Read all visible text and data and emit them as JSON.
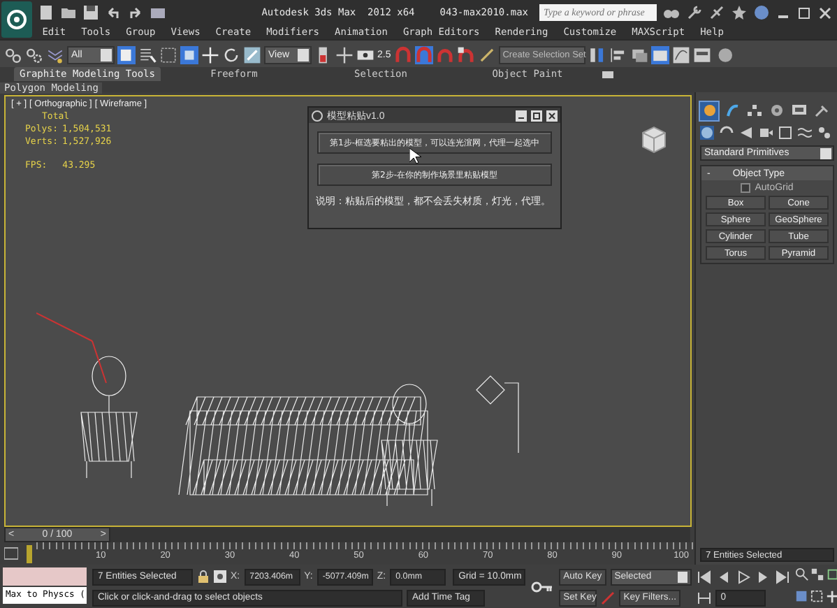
{
  "title_bar": {
    "title": "Autodesk 3ds Max  2012 x64",
    "file": "043-max2010.max",
    "search": {
      "placeholder": "Type a keyword or phrase"
    }
  },
  "menu": [
    "Edit",
    "Tools",
    "Group",
    "Views",
    "Create",
    "Modifiers",
    "Animation",
    "Graph Editors",
    "Rendering",
    "Customize",
    "MAXScript",
    "Help"
  ],
  "toolbar": {
    "selection_filter": "All",
    "reference_coord": "View",
    "snap_angle": "2.5",
    "named_selection": {
      "placeholder": "Create Selection Set"
    }
  },
  "ribbon": {
    "tabs": [
      {
        "label": "Graphite Modeling Tools",
        "selected": true
      },
      {
        "label": "Freeform",
        "selected": false
      },
      {
        "label": "Selection",
        "selected": false
      },
      {
        "label": "Object Paint",
        "selected": false
      }
    ],
    "panel": "Polygon Modeling"
  },
  "viewport": {
    "labels": [
      "[ + ]",
      "[ Orthographic ]",
      "[ Wireframe ]"
    ],
    "heading": "Total",
    "stats": [
      {
        "label": "Polys:",
        "value": "1,504,531"
      },
      {
        "label": "Verts:",
        "value": "1,527,926"
      }
    ],
    "fps": {
      "label": "FPS:",
      "value": "43.295"
    }
  },
  "dialog": {
    "title": "模型粘贴v1.0",
    "buttons": [
      "第1步-框选要粘出的模型，可以连光渲网，代理一起选中",
      "第2步-在你的制作场景里粘贴模型"
    ],
    "note": "说明：粘贴后的模型，都不会丢失材质，灯光，代理。"
  },
  "command_panel": {
    "tabs": [
      {
        "kind": "create",
        "selected": true
      },
      {
        "kind": "modify",
        "selected": false
      },
      {
        "kind": "hierarchy",
        "selected": false
      },
      {
        "kind": "motion",
        "selected": false
      },
      {
        "kind": "display",
        "selected": false
      },
      {
        "kind": "utilities",
        "selected": false
      }
    ],
    "category": "Standard Primitives",
    "rollout": {
      "toggle": "-",
      "title": "Object Type",
      "autogrid": {
        "label": "AutoGrid",
        "checked": false
      },
      "buttons": [
        "Box",
        "Cone",
        "Sphere",
        "GeoSphere",
        "Cylinder",
        "Tube",
        "Torus",
        "Pyramid"
      ]
    },
    "name_field": "7 Entities Selected"
  },
  "timeline": {
    "prev": "<",
    "position": "0 / 100",
    "next": ">",
    "level": 0,
    "ticks": [
      "10",
      "20",
      "30",
      "40",
      "50",
      "60",
      "70",
      "80",
      "90",
      "100"
    ]
  },
  "status": {
    "script_field": "Max to Physcs (",
    "selection": "7 Entities Selected",
    "prompt": "Click or click-and-drag to select objects",
    "coords": [
      {
        "label": "X:",
        "value": "7203.406m"
      },
      {
        "label": "Y:",
        "value": "-5077.409m"
      },
      {
        "label": "Z:",
        "value": "0.0mm"
      }
    ],
    "grid": "Grid = 10.0mm",
    "time_tag": "Add Time Tag",
    "auto_key": "Auto Key",
    "key_mode": "Selected",
    "set_key": "Set Key",
    "key_filters": "Key Filters...",
    "frame": "0"
  }
}
